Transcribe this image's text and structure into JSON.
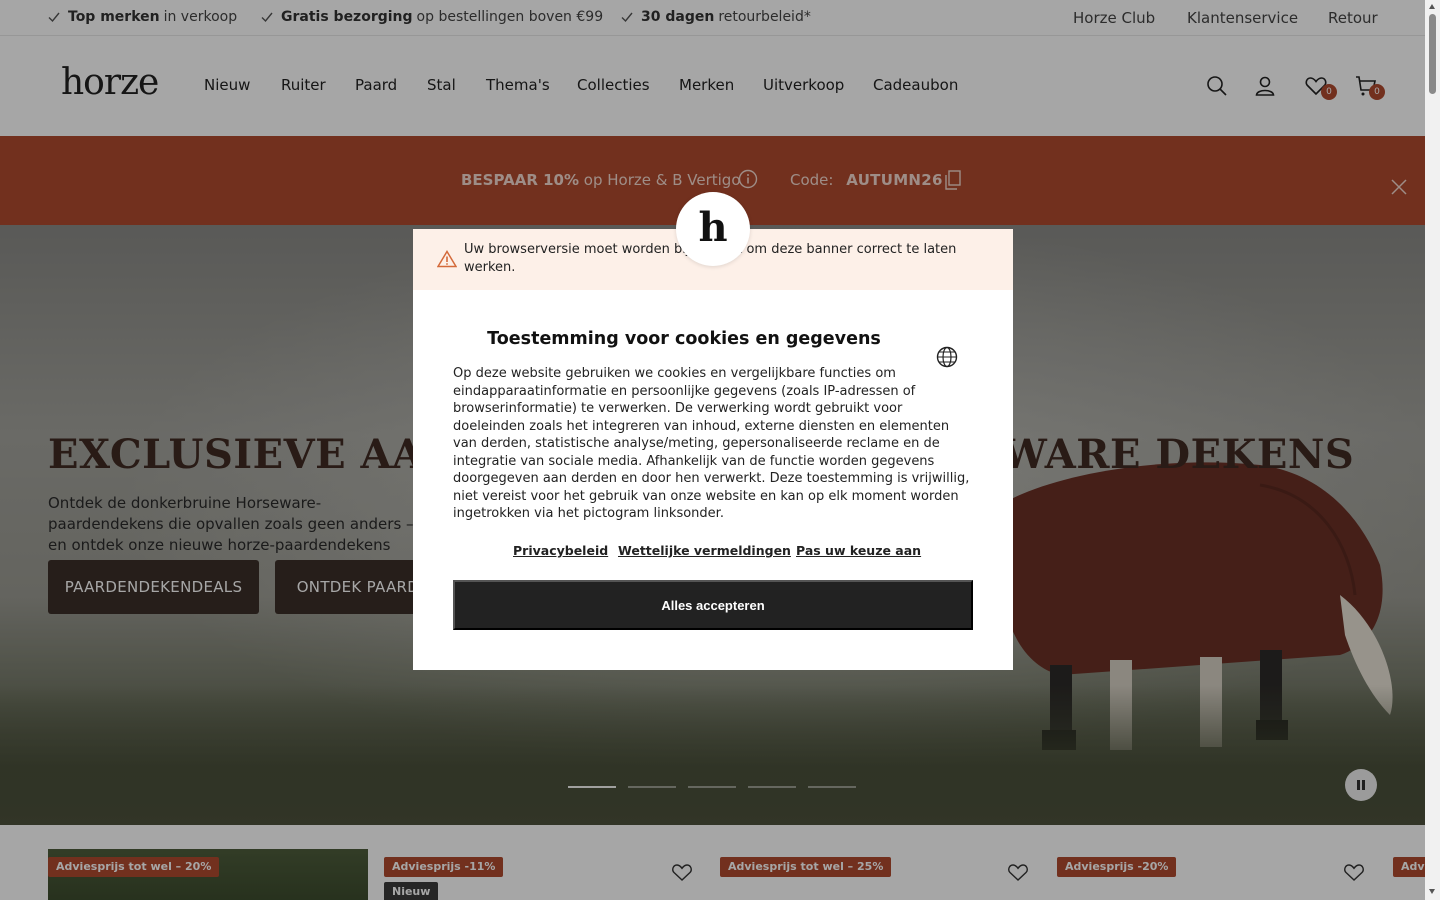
{
  "topbar": {
    "usps": [
      {
        "bold": "Top merken",
        "rest": "in verkoop"
      },
      {
        "bold": "Gratis bezorging",
        "rest": "op bestellingen boven €99"
      },
      {
        "bold": "30 dagen",
        "rest": "retourbeleid*"
      }
    ],
    "links": [
      "Horze Club",
      "Klantenservice",
      "Retour"
    ]
  },
  "header": {
    "logo": "horze",
    "nav": [
      "Nieuw",
      "Ruiter",
      "Paard",
      "Stal",
      "Thema's",
      "Collecties",
      "Merken",
      "Uitverkoop",
      "Cadeaubon"
    ],
    "icons": [
      "search-icon",
      "account-icon",
      "wishlist-icon",
      "cart-icon"
    ],
    "wishlist_count": "0",
    "cart_count": "0"
  },
  "promo": {
    "bold": "BESPAAR 10%",
    "text": "op Horze & B Vertigo",
    "code_label": "Code:",
    "code": "AUTUMN26"
  },
  "hero": {
    "title": "EXCLUSIEVE AANBIEDINGEN OP HORSEWARE DEKENS",
    "subtitle": "Ontdek de donkerbruine Horseware-paardendekens die opvallen zoals geen anders – en ontdek onze nieuwe horze-paardendekens",
    "buttons": [
      "PAARDENDEKENDEALS",
      "ONTDEK PAARDENDEKENS"
    ],
    "slide_count": 5,
    "active_slide": 1
  },
  "products": {
    "tags": [
      "Adviesprijs tot wel – 20%",
      "Adviesprijs -11%",
      "Adviesprijs tot wel – 25%",
      "Adviesprijs -20%",
      "Advi"
    ],
    "new_tag": "Nieuw"
  },
  "cookie_modal": {
    "warning": "Uw browserversie moet worden bijgewerkt om deze banner correct te laten werken.",
    "brand_letter": "h",
    "title": "Toestemming voor cookies en gegevens",
    "body": "Op deze website gebruiken we cookies en vergelijkbare functies om eindapparaatinformatie en persoonlijke gegevens (zoals IP-adressen of browserinformatie) te verwerken. De verwerking wordt gebruikt voor doeleinden zoals het integreren van inhoud, externe diensten en elementen van derden, statistische analyse/meting, gepersonaliseerde reclame en de integratie van sociale media. Afhankelijk van de functie worden gegevens doorgegeven aan derden en door hen verwerkt. Deze toestemming is vrijwillig, niet vereist voor het gebruik van onze website en kan op elk moment worden ingetrokken via het pictogram linksonder.",
    "links": [
      "Privacybeleid",
      "Wettelijke vermeldingen",
      "Pas uw keuze aan"
    ],
    "accept": "Alles accepteren"
  },
  "colors": {
    "brand_rust": "#b04a2e",
    "dark_brown": "#3b2f28",
    "warning_bg": "#fdf0e8"
  }
}
